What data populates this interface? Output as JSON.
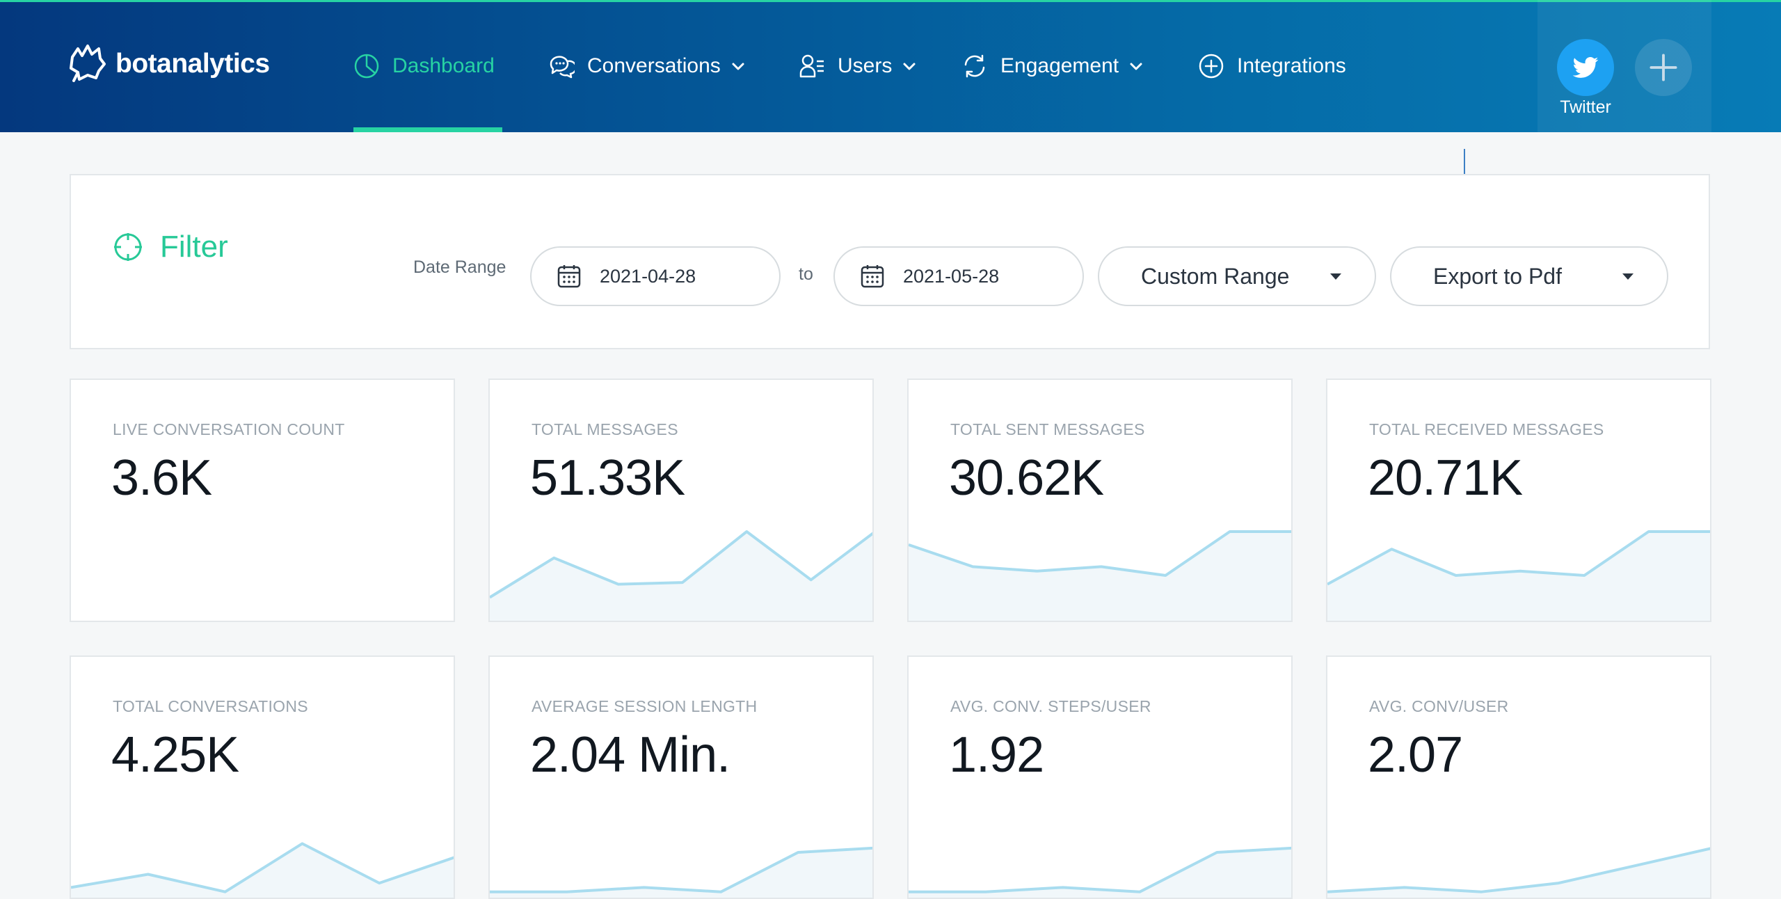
{
  "app": {
    "name": "botanalytics"
  },
  "nav": {
    "items": [
      {
        "label": "Dashboard",
        "icon": "pie-chart-icon",
        "active": true,
        "dropdown": false
      },
      {
        "label": "Conversations",
        "icon": "chat-bubbles-icon",
        "active": false,
        "dropdown": true
      },
      {
        "label": "Users",
        "icon": "user-list-icon",
        "active": false,
        "dropdown": true
      },
      {
        "label": "Engagement",
        "icon": "refresh-cycle-icon",
        "active": false,
        "dropdown": true
      },
      {
        "label": "Integrations",
        "icon": "plus-circle-icon",
        "active": false,
        "dropdown": false
      }
    ]
  },
  "account": {
    "platform_label": "Twitter",
    "platform_icon": "twitter-bird-icon",
    "add_icon": "plus-icon"
  },
  "filter": {
    "title": "Filter",
    "date_range_label": "Date Range",
    "start_date": "2021-04-28",
    "to_label": "to",
    "end_date": "2021-05-28",
    "range_select": "Custom Range",
    "export_select": "Export to Pdf"
  },
  "colors": {
    "accent": "#27d3a3",
    "nav_dark": "#04387e",
    "nav_light": "#077bb6",
    "twitter": "#1da1f2",
    "spark_line": "#a8dcef",
    "spark_fill": "#f1f7fa"
  },
  "cards": [
    {
      "label": "LIVE CONVERSATION COUNT",
      "value": "3.6K",
      "spark": []
    },
    {
      "label": "TOTAL MESSAGES",
      "value": "51.33K",
      "spark": [
        0.25,
        0.7,
        0.4,
        0.42,
        1.0,
        0.45,
        1.0
      ]
    },
    {
      "label": "TOTAL SENT MESSAGES",
      "value": "30.62K",
      "spark": [
        0.85,
        0.6,
        0.55,
        0.6,
        0.5,
        1.0,
        1.0
      ]
    },
    {
      "label": "TOTAL RECEIVED MESSAGES",
      "value": "20.71K",
      "spark": [
        0.4,
        0.8,
        0.5,
        0.55,
        0.5,
        1.0,
        1.0
      ]
    },
    {
      "label": "TOTAL CONVERSATIONS",
      "value": "4.25K",
      "spark": [
        0.1,
        0.25,
        0.05,
        0.6,
        0.15,
        0.45
      ]
    },
    {
      "label": "AVERAGE SESSION LENGTH",
      "value": "2.04 Min.",
      "spark": [
        0.05,
        0.05,
        0.1,
        0.05,
        0.5,
        0.55
      ]
    },
    {
      "label": "AVG. CONV. STEPS/USER",
      "value": "1.92",
      "spark": [
        0.05,
        0.05,
        0.1,
        0.05,
        0.5,
        0.55
      ]
    },
    {
      "label": "AVG. CONV/USER",
      "value": "2.07",
      "spark": [
        0.05,
        0.1,
        0.05,
        0.15,
        0.35,
        0.55
      ]
    }
  ]
}
